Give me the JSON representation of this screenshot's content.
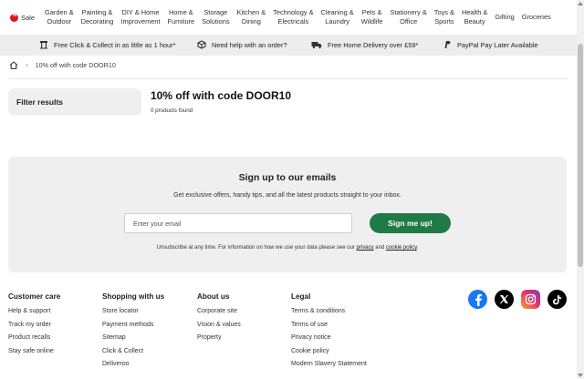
{
  "nav": {
    "sale_label": "Sale",
    "items": [
      "Garden &\nOutdoor",
      "Painting &\nDecorating",
      "DIY & Home\nImprovement",
      "Home &\nFurniture",
      "Storage\nSolutions",
      "Kitchen &\nDining",
      "Technology &\nElectricals",
      "Cleaning &\nLaundry",
      "Pets &\nWildlife",
      "Stationery &\nOffice",
      "Toys &\nSports",
      "Health &\nBeauty",
      "Gifting",
      "Groceries"
    ]
  },
  "promo": {
    "click_collect": "Free Click & Collect in as little as 1 hour*",
    "help": "Need help with an order?",
    "delivery": "Free Home Delivery over £59*",
    "paypal": "PayPal Pay Later Available"
  },
  "breadcrumb": {
    "current": "10% off with code DOOR10"
  },
  "filters": {
    "label": "Filter results"
  },
  "results": {
    "title": "10% off with code DOOR10",
    "count": "0 products found"
  },
  "signup": {
    "title": "Sign up to our emails",
    "subtitle": "Get exclusive offers, handy tips, and all the latest products straight to your inbox.",
    "email_placeholder": "Enter your email",
    "button": "Sign me up!",
    "unsub_text": "Unsubscribe at any time. For information on how we use your data please see our",
    "privacy_link": "privacy",
    "and": "and",
    "cookie_link": "cookie policy",
    "period": "."
  },
  "footer": {
    "customer_care": {
      "heading": "Customer care",
      "links": [
        "Help & support",
        "Track my order",
        "Product recalls",
        "Stay safe online"
      ]
    },
    "shopping": {
      "heading": "Shopping with us",
      "links": [
        "Store locator",
        "Payment methods",
        "Sitemap",
        "Click & Collect",
        "Deliveroo"
      ]
    },
    "about": {
      "heading": "About us",
      "links": [
        "Corporate site",
        "Vision & values",
        "Property"
      ]
    },
    "legal": {
      "heading": "Legal",
      "links": [
        "Terms & conditions",
        "Terms of use",
        "Privacy notice",
        "Cookie policy",
        "Modern Slavery Statement"
      ]
    }
  },
  "socials": [
    "facebook-icon",
    "x-icon",
    "instagram-icon",
    "tiktok-icon"
  ],
  "colors": {
    "accent_green": "#1f7a47",
    "sale_red": "#e0161e",
    "panel_grey": "#efefef"
  }
}
